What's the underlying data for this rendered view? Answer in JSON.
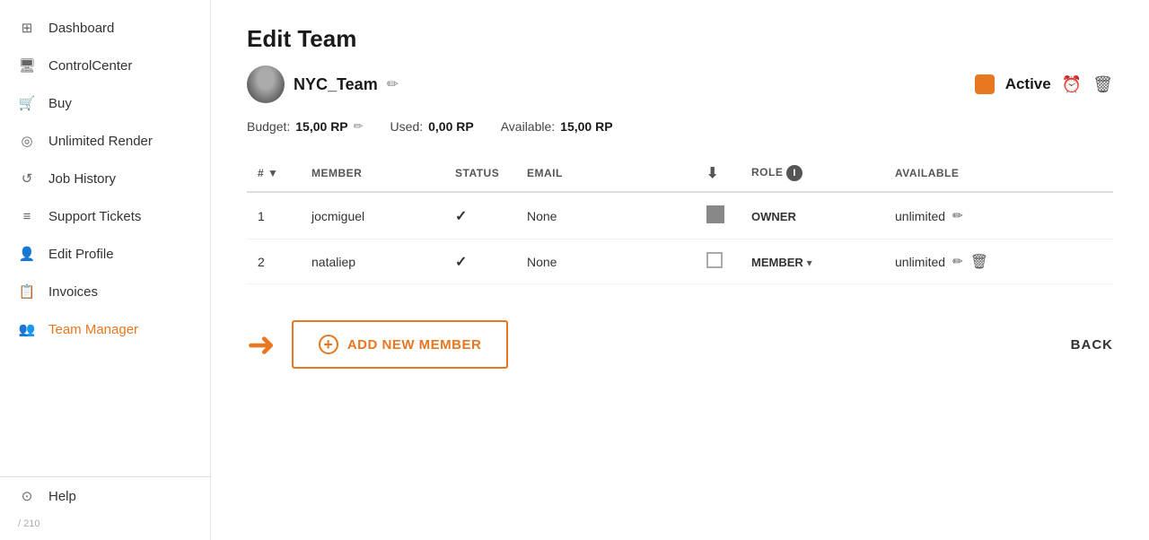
{
  "sidebar": {
    "items": [
      {
        "id": "dashboard",
        "label": "Dashboard",
        "icon": "⊞"
      },
      {
        "id": "control-center",
        "label": "ControlCenter",
        "icon": "🖥"
      },
      {
        "id": "buy",
        "label": "Buy",
        "icon": "🛒"
      },
      {
        "id": "unlimited-render",
        "label": "Unlimited Render",
        "icon": "◎"
      },
      {
        "id": "job-history",
        "label": "Job History",
        "icon": "↺"
      },
      {
        "id": "support-tickets",
        "label": "Support Tickets",
        "icon": "≡"
      },
      {
        "id": "edit-profile",
        "label": "Edit Profile",
        "icon": "👤"
      },
      {
        "id": "invoices",
        "label": "Invoices",
        "icon": "📄"
      },
      {
        "id": "team-manager",
        "label": "Team Manager",
        "icon": "👥"
      }
    ],
    "help": {
      "label": "Help",
      "icon": "?"
    },
    "version": "/ 210"
  },
  "page": {
    "title": "Edit Team",
    "team_name": "NYC_Team",
    "edit_team_icon": "✏",
    "status_label": "Active",
    "budget_label": "Budget:",
    "budget_value": "15,00 RP",
    "used_label": "Used:",
    "used_value": "0,00 RP",
    "available_label": "Available:",
    "available_value": "15,00 RP"
  },
  "table": {
    "headers": [
      {
        "id": "num",
        "label": "#"
      },
      {
        "id": "member",
        "label": "MEMBER"
      },
      {
        "id": "status",
        "label": "STATUS"
      },
      {
        "id": "email",
        "label": "EMAIL"
      },
      {
        "id": "download",
        "label": "⬇"
      },
      {
        "id": "role",
        "label": "ROLE"
      },
      {
        "id": "available",
        "label": "AVAILABLE"
      }
    ],
    "rows": [
      {
        "num": "1",
        "member": "jocmiguel",
        "status_check": "✓",
        "email": "None",
        "role": "OWNER",
        "available": "unlimited",
        "has_dropdown": false,
        "has_delete": false
      },
      {
        "num": "2",
        "member": "nataliep",
        "status_check": "✓",
        "email": "None",
        "role": "MEMBER",
        "available": "unlimited",
        "has_dropdown": true,
        "has_delete": true
      }
    ]
  },
  "actions": {
    "add_member_label": "ADD NEW MEMBER",
    "back_label": "BACK"
  }
}
